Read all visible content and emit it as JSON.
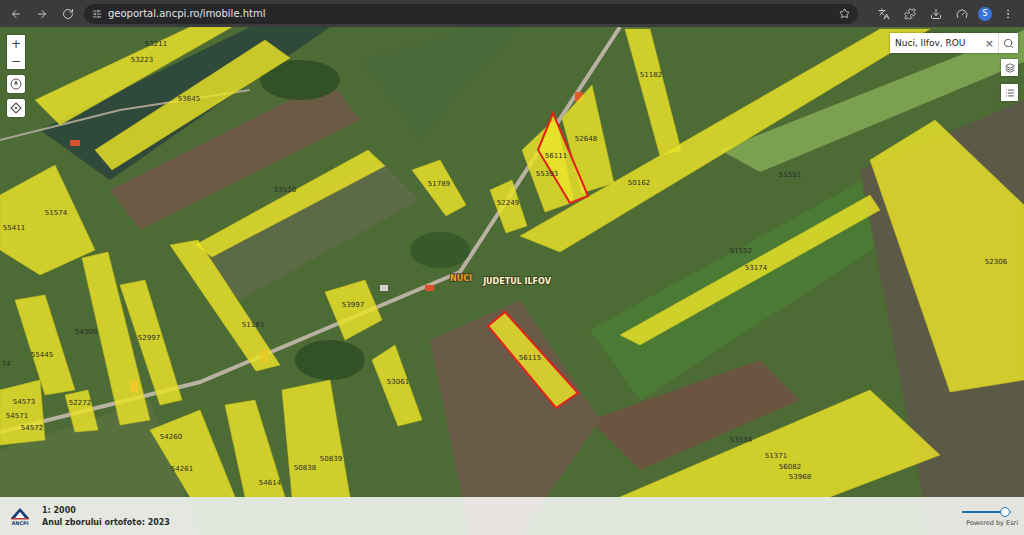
{
  "browser": {
    "url": "geoportal.ancpi.ro/imobile.html",
    "profile": "S"
  },
  "map": {
    "zoom_in": "+",
    "zoom_out": "−",
    "place_labels": [
      {
        "text": "NUCI",
        "kind": "locality"
      },
      {
        "text": "JUDEȚUL ILFOV",
        "kind": "county"
      }
    ],
    "parcels": [
      {
        "label": "53211",
        "selected": false
      },
      {
        "label": "53223",
        "selected": false
      },
      {
        "label": "53645",
        "selected": false
      },
      {
        "label": "53510",
        "selected": false
      },
      {
        "label": "51789",
        "selected": false
      },
      {
        "label": "52249",
        "selected": false
      },
      {
        "label": "55393",
        "selected": false
      },
      {
        "label": "56111",
        "selected": true
      },
      {
        "label": "52648",
        "selected": false
      },
      {
        "label": "51182",
        "selected": false
      },
      {
        "label": "50162",
        "selected": false
      },
      {
        "label": "51551",
        "selected": false
      },
      {
        "label": "51574",
        "selected": false
      },
      {
        "label": "55411",
        "selected": false
      },
      {
        "label": "51552",
        "selected": false
      },
      {
        "label": "53174",
        "selected": false
      },
      {
        "label": "52306",
        "selected": false
      },
      {
        "label": "53997",
        "selected": false
      },
      {
        "label": "51183",
        "selected": false
      },
      {
        "label": "54300",
        "selected": false
      },
      {
        "label": "52997",
        "selected": false
      },
      {
        "label": "55445",
        "selected": false
      },
      {
        "label": "74",
        "selected": false
      },
      {
        "label": "56115",
        "selected": true
      },
      {
        "label": "53061",
        "selected": false
      },
      {
        "label": "52272",
        "selected": false
      },
      {
        "label": "54573",
        "selected": false
      },
      {
        "label": "54571",
        "selected": false
      },
      {
        "label": "54572",
        "selected": false
      },
      {
        "label": "54260",
        "selected": false
      },
      {
        "label": "54261",
        "selected": false
      },
      {
        "label": "50838",
        "selected": false
      },
      {
        "label": "50839",
        "selected": false
      },
      {
        "label": "54614",
        "selected": false
      },
      {
        "label": "53334",
        "selected": false
      },
      {
        "label": "51371",
        "selected": false
      },
      {
        "label": "56082",
        "selected": false
      },
      {
        "label": "53968",
        "selected": false
      }
    ]
  },
  "search": {
    "value": "Nuci, Ilfov, ROU",
    "clear": "×"
  },
  "footer": {
    "logo": "ANCPI",
    "scale": "1: 2000",
    "ortho_year": "Anul zborului ortofoto: 2023",
    "opacity_level": 0.85,
    "credit": "Powered by Esri"
  }
}
